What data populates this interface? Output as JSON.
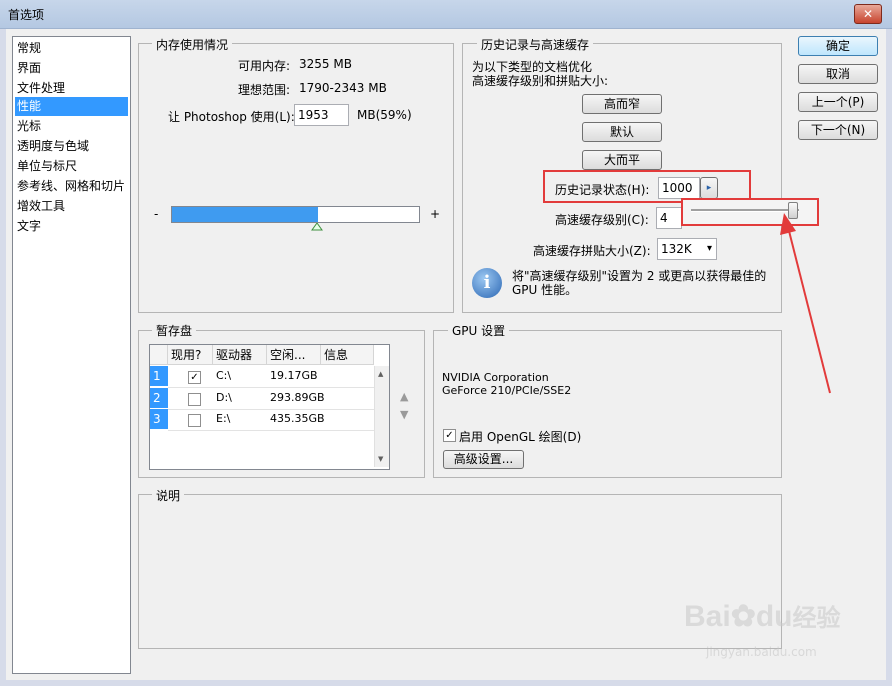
{
  "window": {
    "title": "首选项",
    "close_glyph": "✕"
  },
  "sidebar": {
    "items": [
      {
        "label": "常规"
      },
      {
        "label": "界面"
      },
      {
        "label": "文件处理"
      },
      {
        "label": "性能"
      },
      {
        "label": "光标"
      },
      {
        "label": "透明度与色域"
      },
      {
        "label": "单位与标尺"
      },
      {
        "label": "参考线、网格和切片"
      },
      {
        "label": "增效工具"
      },
      {
        "label": "文字"
      }
    ],
    "selected_index": 3
  },
  "memory": {
    "legend": "内存使用情况",
    "available_label": "可用内存:",
    "available_value": "3255 MB",
    "range_label": "理想范围:",
    "range_value": "1790-2343 MB",
    "let_label": "让 Photoshop 使用(L):",
    "let_value": "1953",
    "let_suffix": "MB(59%)",
    "minus": "-",
    "plus": "+",
    "percent": 59
  },
  "history": {
    "legend": "历史记录与高速缓存",
    "optimize_line1": "为以下类型的文档优化",
    "optimize_line2": "高速缓存级别和拼贴大小:",
    "btn_tall_thin": "高而窄",
    "btn_default": "默认",
    "btn_big_flat": "大而平",
    "states_label": "历史记录状态(H):",
    "states_value": "1000",
    "cache_levels_label": "高速缓存级别(C):",
    "cache_levels_value": "4",
    "tile_size_label": "高速缓存拼贴大小(Z):",
    "tile_size_value": "132K",
    "info_text_line1": "将\"高速缓存级别\"设置为 2 或更高以获得最佳的",
    "info_text_line2": "GPU 性能。",
    "info_glyph": "i",
    "arrow_glyph": "▸",
    "dropdown_glyph": "▾"
  },
  "scratch": {
    "legend": "暂存盘",
    "headers": [
      "现用?",
      "驱动器",
      "空闲...",
      "信息"
    ],
    "rows": [
      {
        "num": "1",
        "active": "✓",
        "drive": "C:\\",
        "free": "19.17GB"
      },
      {
        "num": "2",
        "active": "",
        "drive": "D:\\",
        "free": "293.89GB"
      },
      {
        "num": "3",
        "active": "",
        "drive": "E:\\",
        "free": "435.35GB"
      }
    ],
    "up_glyph": "▲",
    "down_glyph": "▼"
  },
  "gpu": {
    "legend": "GPU 设置",
    "vendor": "NVIDIA Corporation",
    "model": "GeForce 210/PCIe/SSE2",
    "opengl_label": "启用 OpenGL 绘图(D)",
    "opengl_check": "✓",
    "advanced_button": "高级设置..."
  },
  "description": {
    "legend": "说明"
  },
  "actions": {
    "ok": "确定",
    "cancel": "取消",
    "prev": "上一个(P)",
    "next": "下一个(N)"
  },
  "watermark": {
    "brand": "Bai",
    "brand_suffix": "du",
    "brand_cn": "经验",
    "url": "jingyan.baidu.com"
  },
  "colors": {
    "accent": "#3399ff",
    "annotation": "#e23b3b"
  }
}
